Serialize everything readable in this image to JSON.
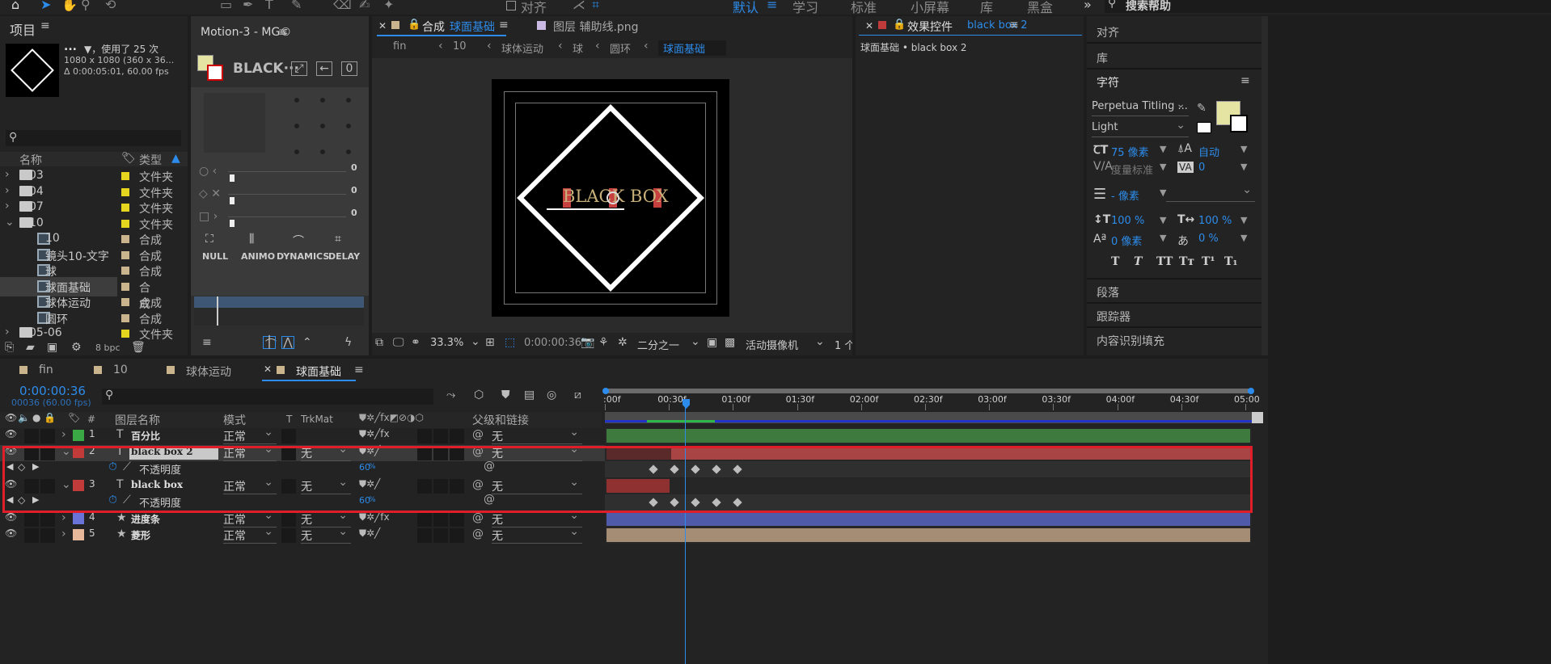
{
  "toolbar": {
    "workspaces": [
      "默认",
      "学习",
      "标准",
      "小屏幕",
      "库",
      "黑盒"
    ],
    "active_workspace": "默认",
    "align_label": "对齐",
    "search_placeholder": "搜索帮助"
  },
  "project": {
    "title": "项目",
    "comp_name": "...",
    "usage": "▼，使用了 25 次",
    "resolution": "1080 x 1080  (360 x 36...",
    "duration": "Δ 0:00:05:01, 60.00 fps",
    "col_name": "名称",
    "col_type": "类型",
    "bpc": "8 bpc",
    "items": [
      {
        "name": "03",
        "type": "文件夹",
        "kind": "folder",
        "color": "#e6d51f",
        "expanded": false
      },
      {
        "name": "04",
        "type": "文件夹",
        "kind": "folder",
        "color": "#e6d51f",
        "expanded": false
      },
      {
        "name": "07",
        "type": "文件夹",
        "kind": "folder",
        "color": "#e6d51f",
        "expanded": false
      },
      {
        "name": "10",
        "type": "文件夹",
        "kind": "folder",
        "color": "#e6d51f",
        "expanded": true
      },
      {
        "name": "10",
        "type": "合成",
        "kind": "comp",
        "color": "#c9b48d"
      },
      {
        "name": "镜头10-文字",
        "type": "合成",
        "kind": "comp",
        "color": "#c9b48d"
      },
      {
        "name": "球",
        "type": "合成",
        "kind": "comp",
        "color": "#c9b48d"
      },
      {
        "name": "球面基础",
        "type": "合成",
        "kind": "comp",
        "color": "#c9b48d",
        "selected": true
      },
      {
        "name": "球体运动",
        "type": "合成",
        "kind": "comp",
        "color": "#c9b48d"
      },
      {
        "name": "圆环",
        "type": "合成",
        "kind": "comp",
        "color": "#c9b48d"
      },
      {
        "name": "05-06",
        "type": "文件夹",
        "kind": "folder",
        "color": "#e6d51f",
        "expanded": false
      }
    ]
  },
  "motion": {
    "title": "Motion-3 - MG©",
    "name": "BLACK···",
    "zero": "0",
    "sliders": [
      "0",
      "0",
      "0"
    ],
    "tools": [
      "NULL",
      "ANIMO",
      "DYNAMICS",
      "DELAY"
    ]
  },
  "comp": {
    "tab_prefix": "合成",
    "tab_name": "球面基础",
    "tab2": "图层 辅助线.png",
    "breadcrumbs": [
      "fin",
      "10",
      "球体运动",
      "球",
      "圆环",
      "球面基础"
    ],
    "zoom": "33.3%",
    "timecode": "0:00:00:36",
    "resolution": "二分之一",
    "camera": "活动摄像机",
    "views": "1 个",
    "canvas_text": "BLACK BOX"
  },
  "effects": {
    "title_prefix": "效果控件",
    "title_layer": "black box 2",
    "subtitle": "球面基础 • black box 2"
  },
  "right": {
    "align": "对齐",
    "library": "库",
    "character": "字符",
    "font": "Perpetua Titling ...",
    "style": "Light",
    "size": "75 像素",
    "leading": "自动",
    "kerning": "度量标准",
    "tracking": "0",
    "stroke": "- 像素",
    "vscale": "100 %",
    "hscale": "100 %",
    "baseline": "0 像素",
    "tsume": "0 %",
    "type_buttons": [
      "T",
      "T",
      "TT",
      "Tт",
      "T¹",
      "T₁"
    ],
    "paragraph": "段落",
    "tracker": "跟踪器",
    "content_fill": "内容识别填充"
  },
  "timeline": {
    "tabs": [
      "fin",
      "10",
      "球体运动",
      "球面基础"
    ],
    "active_tab": "球面基础",
    "timecode": "0:00:00:36",
    "frames": "00036 (60.00 fps)",
    "col_name": "图层名称",
    "col_mode": "模式",
    "col_t": "T",
    "col_trkmat": "TrkMat",
    "col_parent": "父级和链接",
    "ruler": [
      ":00f",
      "00:30f",
      "01:00f",
      "01:30f",
      "02:00f",
      "02:30f",
      "03:00f",
      "03:30f",
      "04:00f",
      "04:30f",
      "05:00"
    ],
    "layers": [
      {
        "num": "1",
        "name": "百分比",
        "icon": "T",
        "color": "#3aa845",
        "mode": "正常",
        "trkmat": "",
        "parent": "无",
        "bar": "#3e7a3e",
        "fx": true
      },
      {
        "num": "2",
        "name": "black box 2",
        "icon": "T",
        "color": "#c23b3b",
        "mode": "正常",
        "trkmat": "无",
        "parent": "无",
        "bar": "#a84444",
        "selected": true
      },
      {
        "prop": true,
        "name": "不透明度",
        "value": "60",
        "unit": "%"
      },
      {
        "num": "3",
        "name": "black box",
        "icon": "T",
        "color": "#c23b3b",
        "mode": "正常",
        "trkmat": "无",
        "parent": "无",
        "bar": "#8f3131"
      },
      {
        "prop": true,
        "name": "不透明度",
        "value": "60",
        "unit": "%"
      },
      {
        "num": "4",
        "name": "进度条",
        "icon": "★",
        "color": "#6a74d8",
        "mode": "正常",
        "trkmat": "无",
        "parent": "无",
        "bar": "#4f5aa8",
        "fx": true
      },
      {
        "num": "5",
        "name": "菱形",
        "icon": "★",
        "color": "#e8b89a",
        "mode": "正常",
        "trkmat": "无",
        "parent": "无",
        "bar": "#a58c74"
      }
    ]
  },
  "colors": {
    "accent": "#2d8ceb",
    "highlight_border": "#e01e2a",
    "swatch": "#e6e4a3"
  }
}
